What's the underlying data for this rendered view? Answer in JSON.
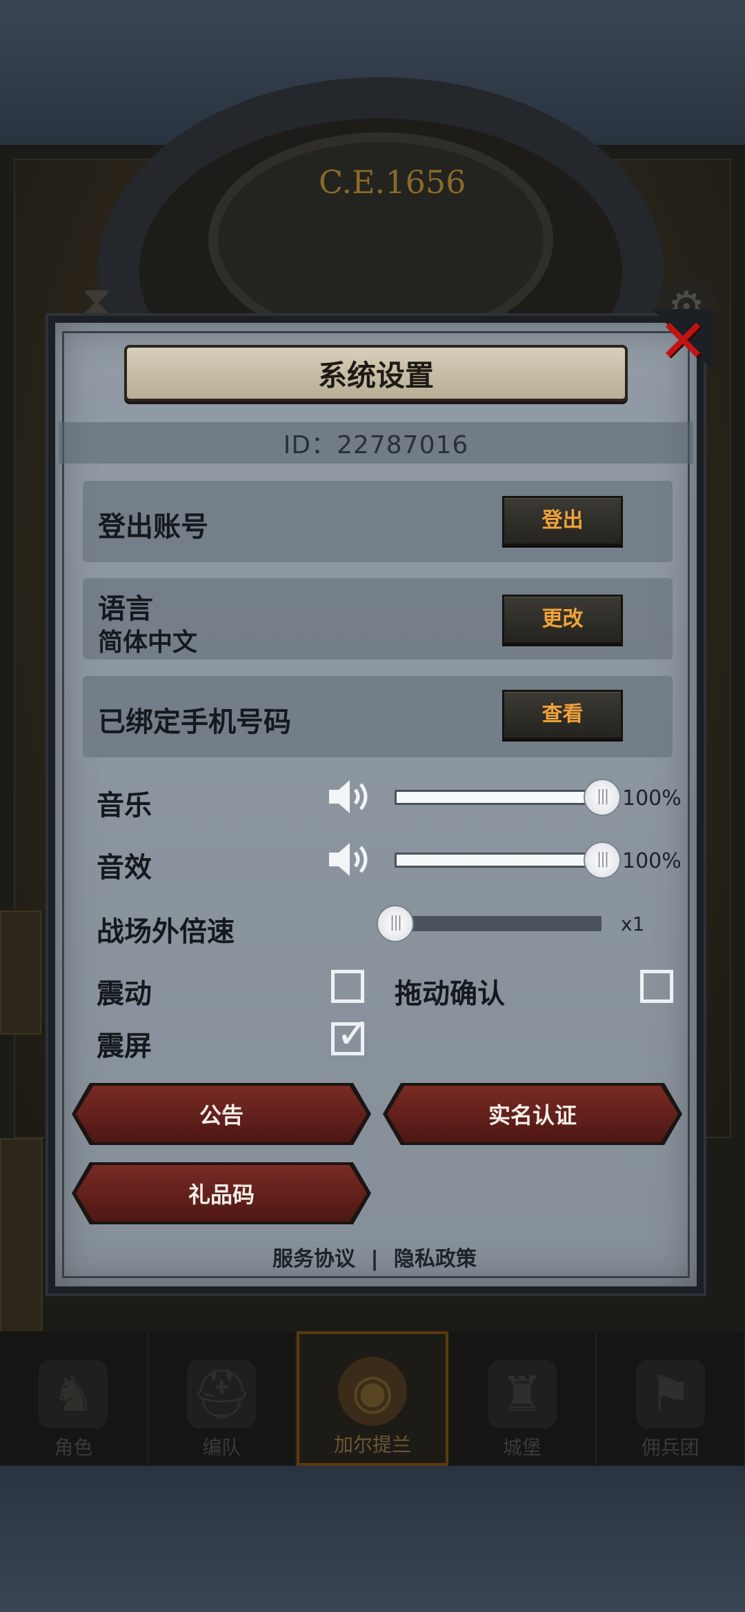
{
  "scene": {
    "calendar_label": "C.E.1656"
  },
  "dialog": {
    "title": "系统设置",
    "id_text": "ID：22787016",
    "account": {
      "label": "登出账号",
      "button": "登出"
    },
    "language": {
      "label": "语言",
      "value": "简体中文",
      "button": "更改"
    },
    "phone": {
      "label": "已绑定手机号码",
      "button": "查看"
    },
    "music": {
      "label": "音乐",
      "value_text": "100%",
      "level": 1.0
    },
    "sfx": {
      "label": "音效",
      "value_text": "100%",
      "level": 1.0
    },
    "speed": {
      "label": "战场外倍速",
      "value_text": "x1",
      "level": 0.0
    },
    "vibrate": {
      "label": "震动",
      "checked": false
    },
    "drag_confirm": {
      "label": "拖动确认",
      "checked": false
    },
    "screen_shake": {
      "label": "震屏",
      "checked": true
    },
    "buttons": {
      "announcement": "公告",
      "realname": "实名认证",
      "giftcode": "礼品码"
    },
    "footer": {
      "service": "服务协议",
      "separator": "|",
      "privacy": "隐私政策"
    }
  },
  "nav": {
    "items": [
      {
        "label": "角色",
        "icon": "knight-icon"
      },
      {
        "label": "编队",
        "icon": "helmet-icon"
      },
      {
        "label": "加尔提兰",
        "icon": "globe-emblem-icon",
        "active": true
      },
      {
        "label": "城堡",
        "icon": "castle-icon"
      },
      {
        "label": "佣兵团",
        "icon": "banner-icon"
      }
    ]
  }
}
